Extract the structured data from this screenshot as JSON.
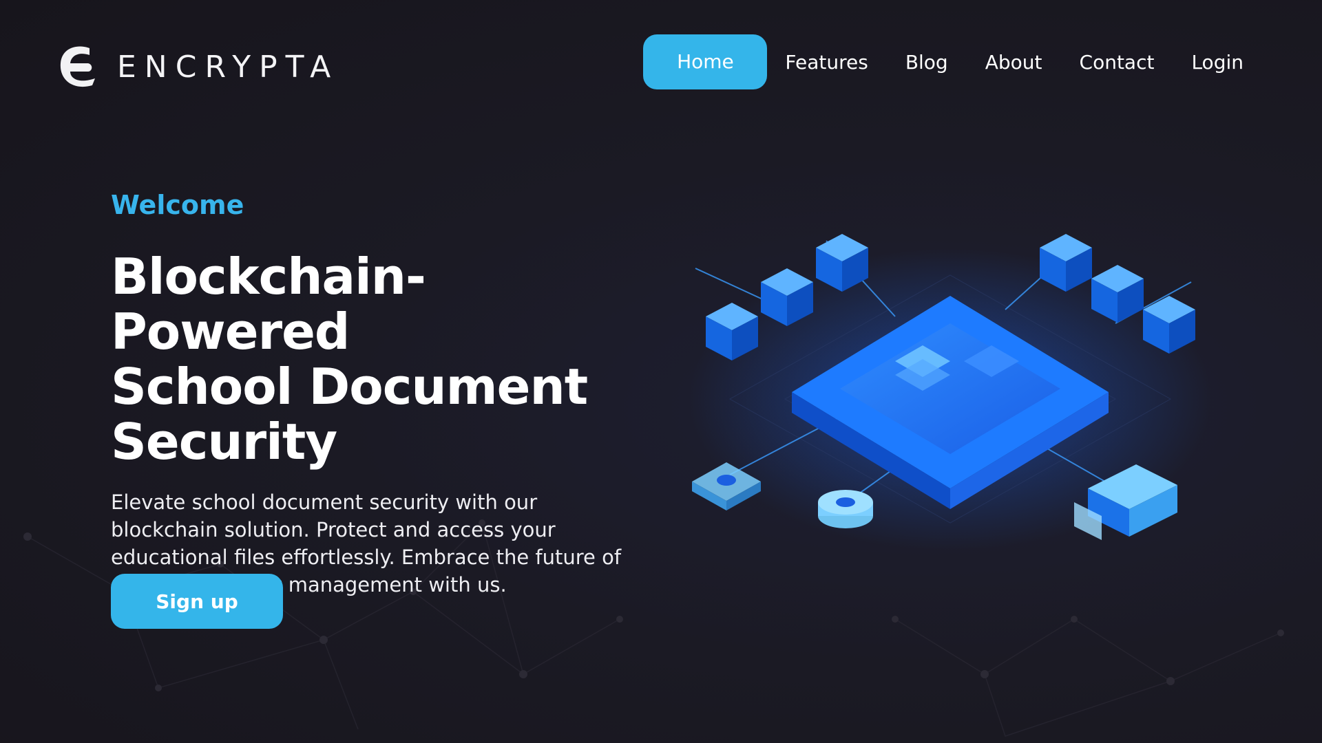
{
  "brand": {
    "name": "ENCRYPTA",
    "logo_icon": "encrypta-e-logo-icon"
  },
  "nav": {
    "items": [
      {
        "label": "Home",
        "active": true
      },
      {
        "label": "Features"
      },
      {
        "label": "Blog"
      },
      {
        "label": "About"
      },
      {
        "label": "Contact"
      },
      {
        "label": "Login"
      }
    ]
  },
  "hero": {
    "eyebrow": "Welcome",
    "title_lines": [
      "Blockchain-Powered",
      "School Document",
      "Security"
    ],
    "description": "Elevate school document security with our blockchain solution. Protect and access your educational files effortlessly. Embrace the future of school document management with us.",
    "cta_label": "Sign up",
    "illustration_icon": "blockchain-isometric-illustration"
  },
  "colors": {
    "accent": "#34b5ea",
    "background": "#1b1a22",
    "text": "#ffffff"
  }
}
